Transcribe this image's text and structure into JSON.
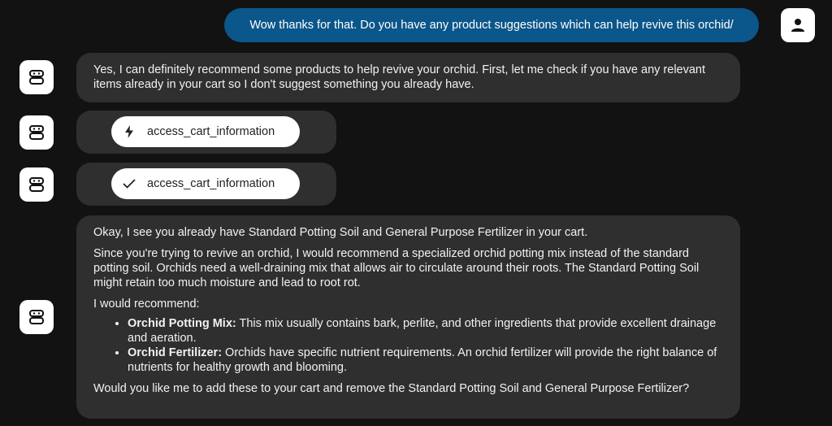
{
  "user_message": {
    "text": "Wow thanks for that. Do you have any product suggestions which can help revive this orchid/"
  },
  "assistant_intro": {
    "text": "Yes, I can definitely recommend some products to help revive your orchid. First, let me check if you have any relevant items already in your cart so I don't suggest something you already have."
  },
  "tool_calls": [
    {
      "status_icon": "lightning-bolt-icon",
      "label": "access_cart_information"
    },
    {
      "status_icon": "checkmark-icon",
      "label": "access_cart_information"
    }
  ],
  "assistant_reply": {
    "p1": "Okay, I see you already have Standard Potting Soil and General Purpose Fertilizer in your cart.",
    "p2": "Since you're trying to revive an orchid, I would recommend a specialized orchid potting mix instead of the standard potting soil. Orchids need a well-draining mix that allows air to circulate around their roots. The Standard Potting Soil might retain too much moisture and lead to root rot.",
    "p3": "I would recommend:",
    "recommendations": [
      {
        "name": "Orchid Potting Mix:",
        "description": " This mix usually contains bark, perlite, and other ingredients that provide excellent drainage and aeration."
      },
      {
        "name": "Orchid Fertilizer:",
        "description": " Orchids have specific nutrient requirements. An orchid fertilizer will provide the right balance of nutrients for healthy growth and blooming."
      }
    ],
    "closing": "Would you like me to add these to your cart and remove the Standard Potting Soil and General Purpose Fertilizer?"
  },
  "colors": {
    "background": "#121212",
    "user_bubble": "#0b568a",
    "assistant_bubble": "#2f2f2f",
    "avatar_bg": "#ffffff"
  }
}
